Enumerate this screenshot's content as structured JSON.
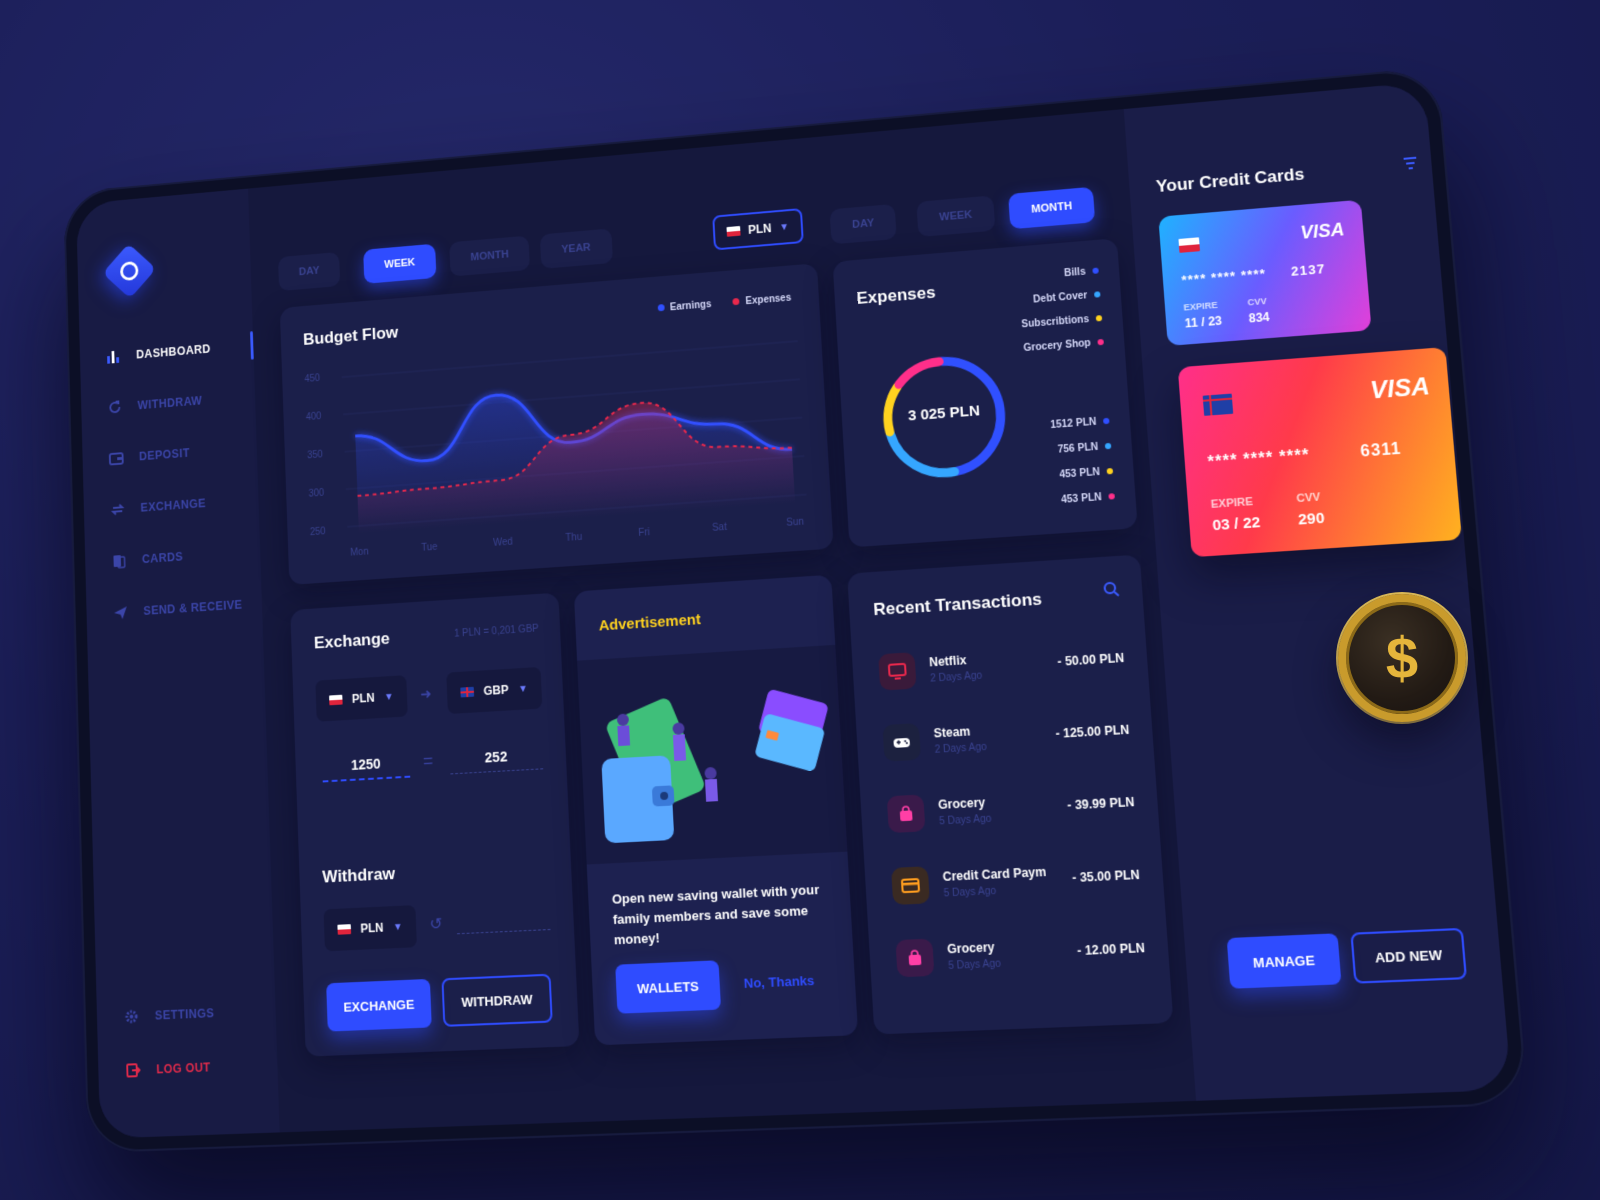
{
  "sidebar": {
    "items": [
      {
        "label": "DASHBOARD",
        "icon": "bar-chart-icon",
        "active": true
      },
      {
        "label": "WITHDRAW",
        "icon": "refresh-icon"
      },
      {
        "label": "DEPOSIT",
        "icon": "wallet-icon"
      },
      {
        "label": "EXCHANGE",
        "icon": "exchange-icon"
      },
      {
        "label": "CARDS",
        "icon": "cards-icon"
      },
      {
        "label": "SEND & RECEIVE",
        "icon": "send-icon"
      }
    ],
    "settings": "SETTINGS",
    "logout": "LOG OUT"
  },
  "budget": {
    "periods": [
      "DAY",
      "WEEK",
      "MONTH",
      "YEAR"
    ],
    "active_period": "WEEK",
    "currency": "PLN",
    "title": "Budget Flow",
    "legend": [
      {
        "label": "Earnings",
        "color": "#3050ff"
      },
      {
        "label": "Expenses",
        "color": "#e8284c"
      }
    ]
  },
  "chart_data": {
    "type": "line",
    "title": "Budget Flow",
    "categories": [
      "Mon",
      "Tue",
      "Wed",
      "Thu",
      "Fri",
      "Sat",
      "Sun"
    ],
    "ylim": [
      250,
      450
    ],
    "yticks": [
      "450",
      "400",
      "350",
      "300",
      "250"
    ],
    "grid": true,
    "legend_position": "top-right",
    "series": [
      {
        "name": "Earnings",
        "color": "#3050ff",
        "values": [
          370,
          330,
          410,
          340,
          370,
          350,
          310
        ]
      },
      {
        "name": "Expenses",
        "color": "#e8284c",
        "values": [
          290,
          293,
          297,
          350,
          385,
          320,
          312
        ]
      }
    ]
  },
  "expenses": {
    "periods": [
      "DAY",
      "WEEK",
      "MONTH"
    ],
    "active_period": "MONTH",
    "title": "Expenses",
    "total": "3 025 PLN",
    "categories": [
      {
        "label": "Bills",
        "color": "#3050ff"
      },
      {
        "label": "Debt Cover",
        "color": "#35a6ff"
      },
      {
        "label": "Subscribtions",
        "color": "#ffd21f"
      },
      {
        "label": "Grocery Shop",
        "color": "#ff2f8a"
      }
    ],
    "amounts": [
      "1512 PLN",
      "756 PLN",
      "453 PLN",
      "453 PLN"
    ],
    "donut_values": [
      1512,
      756,
      453,
      453
    ]
  },
  "exchange": {
    "title": "Exchange",
    "rate": "1 PLN = 0,201 GBP",
    "from_currency": "PLN",
    "to_currency": "GBP",
    "from_amount": "1250",
    "to_amount": "252",
    "equals": "="
  },
  "withdraw": {
    "title": "Withdraw",
    "currency": "PLN",
    "exchange_button": "EXCHANGE",
    "withdraw_button": "WITHDRAW"
  },
  "advert": {
    "title": "Advertisement",
    "text": "Open new saving wallet with your family members and save some money!",
    "wallets_button": "WALLETS",
    "decline_link": "No, Thanks"
  },
  "transactions": {
    "title": "Recent Transactions",
    "items": [
      {
        "name": "Netflix",
        "date": "2 Days Ago",
        "amount": "- 50.00 PLN",
        "icon": "tv-icon",
        "color": "#e8284c",
        "bg": "#3a1a3a"
      },
      {
        "name": "Steam",
        "date": "2 Days Ago",
        "amount": "- 125.00 PLN",
        "icon": "gamepad-icon",
        "color": "#ffffff",
        "bg": "#1c213f"
      },
      {
        "name": "Grocery",
        "date": "5 Days Ago",
        "amount": "- 39.99 PLN",
        "icon": "shopping-bag-icon",
        "color": "#ff3fa6",
        "bg": "#3a1a4a"
      },
      {
        "name": "Credit Card Payment",
        "date": "5 Days Ago",
        "amount": "- 35.00 PLN",
        "icon": "credit-card-icon",
        "color": "#ff9e1f",
        "bg": "#3a2a22"
      },
      {
        "name": "Grocery",
        "date": "5 Days Ago",
        "amount": "- 12.00 PLN",
        "icon": "shopping-bag-icon",
        "color": "#ff3fa6",
        "bg": "#3a1a4a"
      }
    ]
  },
  "cards": {
    "title": "Your Credit Cards",
    "list": [
      {
        "brand": "VISA",
        "masked": "**** **** ****",
        "last4": "2137",
        "expire_label": "EXPIRE",
        "expire": "11 / 23",
        "cvv_label": "CVV",
        "cvv": "834",
        "flag": "pl"
      },
      {
        "brand": "VISA",
        "masked": "**** **** ****",
        "last4": "6311",
        "expire_label": "EXPIRE",
        "expire": "03 / 22",
        "cvv_label": "CVV",
        "cvv": "290",
        "flag": "gb"
      }
    ],
    "manage_button": "MANAGE",
    "add_button": "ADD NEW"
  }
}
